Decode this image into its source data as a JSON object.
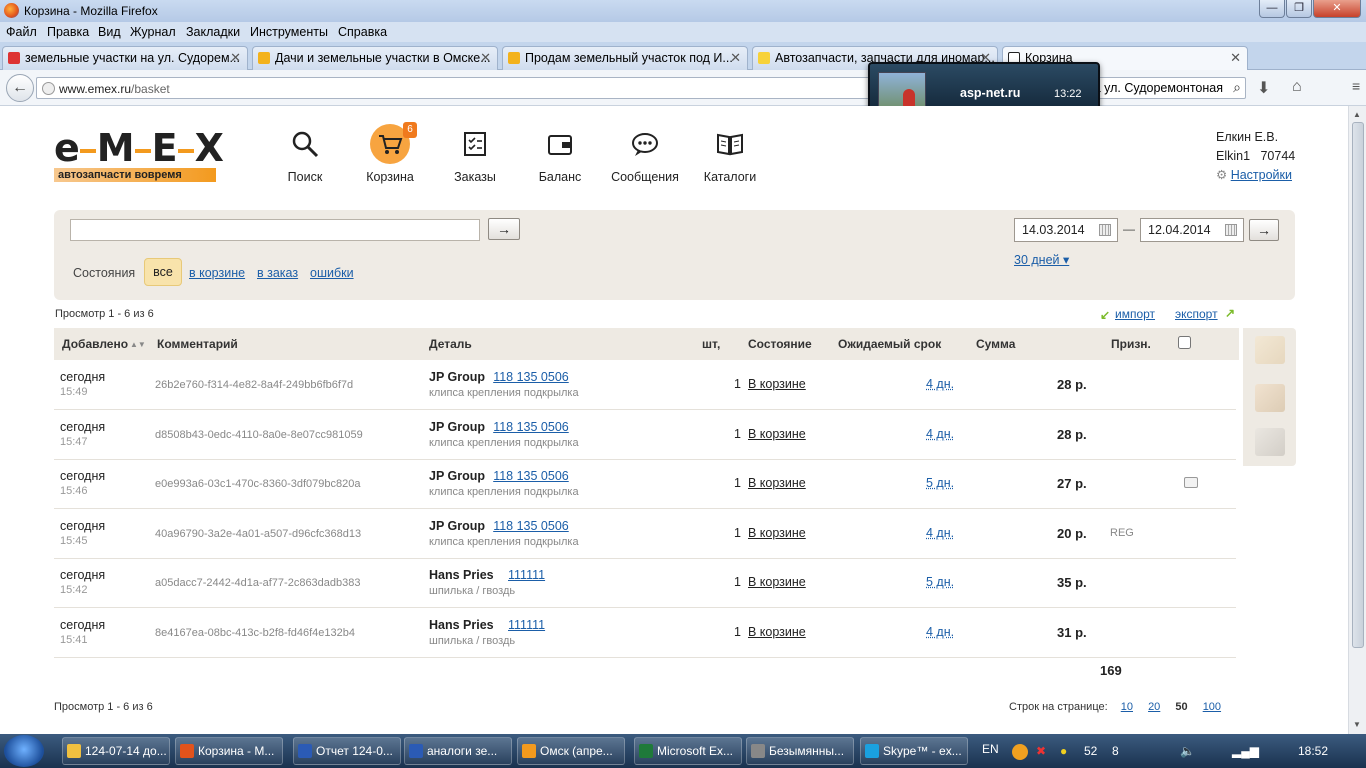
{
  "window": {
    "title": "Корзина - Mozilla Firefox"
  },
  "menu": [
    "Файл",
    "Правка",
    "Вид",
    "Журнал",
    "Закладки",
    "Инструменты",
    "Справка"
  ],
  "tabs": [
    {
      "label": "земельные участки на ул. Судорем...",
      "fav": "#d33"
    },
    {
      "label": "Дачи и земельные участки в Омске...",
      "fav": "#f3b21c"
    },
    {
      "label": "Продам земельный участок под И...",
      "fav": "#f3b21c"
    },
    {
      "label": "Автозапчасти, запчасти для иномар...",
      "fav": "#f7d23a"
    },
    {
      "label": "Корзина",
      "fav": "#222"
    }
  ],
  "nav": {
    "url_host": "www.emex.ru",
    "url_path": "/basket",
    "search": "а ул. Судоремонтоная"
  },
  "notification": {
    "site": "asp-net.ru",
    "time": "13:22"
  },
  "brand": {
    "tagline": "автозапчасти вовремя"
  },
  "topnav": [
    {
      "label": "Поиск",
      "icon": "search-icon"
    },
    {
      "label": "Корзина",
      "icon": "cart-icon",
      "badge": "6"
    },
    {
      "label": "Заказы",
      "icon": "orders-icon"
    },
    {
      "label": "Баланс",
      "icon": "wallet-icon"
    },
    {
      "label": "Сообщения",
      "icon": "chat-icon"
    },
    {
      "label": "Каталоги",
      "icon": "book-icon"
    }
  ],
  "user": {
    "name": "Елкин Е.В.",
    "login": "Elkin1",
    "id": "70744",
    "settings": "Настройки"
  },
  "filter": {
    "go": "→",
    "date_from": "14.03.2014",
    "dash": "—",
    "date_to": "12.04.2014",
    "states_label": "Состояния",
    "states": [
      "все",
      "в корзине",
      "в заказ",
      "ошибки"
    ],
    "period": "30 дней ▾"
  },
  "view_label": "Просмотр 1 - 6 из 6",
  "import": "импорт",
  "export": "экспорт",
  "columns": {
    "added": "Добавлено",
    "comment": "Комментарий",
    "part": "Деталь",
    "qty": "шт,",
    "state": "Состояние",
    "expected": "Ожидаемый срок",
    "sum": "Сумма",
    "sign": "Призн."
  },
  "rows": [
    {
      "day": "сегодня",
      "time": "15:49",
      "comment": "26b2e760-f314-4e82-8a4f-249bb6fb6f7d",
      "brand": "JP Group",
      "number": "118 135 0506",
      "desc": "клипса крепления подкрылка",
      "qty": "1",
      "state": "В корзине",
      "eta": "4 дн.",
      "sum": "28 р.",
      "sign": "",
      "msg": false
    },
    {
      "day": "сегодня",
      "time": "15:47",
      "comment": "d8508b43-0edc-4110-8a0e-8e07cc981059",
      "brand": "JP Group",
      "number": "118 135 0506",
      "desc": "клипса крепления подкрылка",
      "qty": "1",
      "state": "В корзине",
      "eta": "4 дн.",
      "sum": "28 р.",
      "sign": "",
      "msg": false
    },
    {
      "day": "сегодня",
      "time": "15:46",
      "comment": "e0e993a6-03c1-470c-8360-3df079bc820a",
      "brand": "JP Group",
      "number": "118 135 0506",
      "desc": "клипса крепления подкрылка",
      "qty": "1",
      "state": "В корзине",
      "eta": "5 дн.",
      "sum": "27 р.",
      "sign": "",
      "msg": true
    },
    {
      "day": "сегодня",
      "time": "15:45",
      "comment": "40a96790-3a2e-4a01-a507-d96cfc368d13",
      "brand": "JP Group",
      "number": "118 135 0506",
      "desc": "клипса крепления подкрылка",
      "qty": "1",
      "state": "В корзине",
      "eta": "4 дн.",
      "sum": "20 р.",
      "sign": "REG",
      "msg": false
    },
    {
      "day": "сегодня",
      "time": "15:42",
      "comment": "a05dacc7-2442-4d1a-af77-2c863dadb383",
      "brand": "Hans Pries",
      "number": "111111",
      "desc": "шпилька / гвоздь",
      "qty": "1",
      "state": "В корзине",
      "eta": "5 дн.",
      "sum": "35 р.",
      "sign": "",
      "msg": false
    },
    {
      "day": "сегодня",
      "time": "15:41",
      "comment": "8e4167ea-08bc-413c-b2f8-fd46f4e132b4",
      "brand": "Hans Pries",
      "number": "111111",
      "desc": "шпилька / гвоздь",
      "qty": "1",
      "state": "В корзине",
      "eta": "4 дн.",
      "sum": "31 р.",
      "sign": "",
      "msg": false
    }
  ],
  "total": "169",
  "pager": {
    "label": "Строк на странице:",
    "options": [
      "10",
      "20",
      "50",
      "100"
    ],
    "current": "50"
  },
  "taskbar": [
    {
      "label": "124-07-14 до...",
      "color": "#f0c040"
    },
    {
      "label": "Корзина - M...",
      "color": "#e2531c"
    },
    {
      "label": "Отчет 124-0...",
      "color": "#2b5bb5"
    },
    {
      "label": "аналоги зе...",
      "color": "#2b5bb5"
    },
    {
      "label": "Омск (апре...",
      "color": "#f39a1e"
    },
    {
      "label": "Microsoft Ex...",
      "color": "#1f7a3a"
    },
    {
      "label": "Безымянны...",
      "color": "#888"
    },
    {
      "label": "Skype™ - ex...",
      "color": "#1aa1e0"
    }
  ],
  "tray": {
    "lang": "EN",
    "count_a": "52",
    "count_b": "8",
    "clock": "18:52"
  }
}
